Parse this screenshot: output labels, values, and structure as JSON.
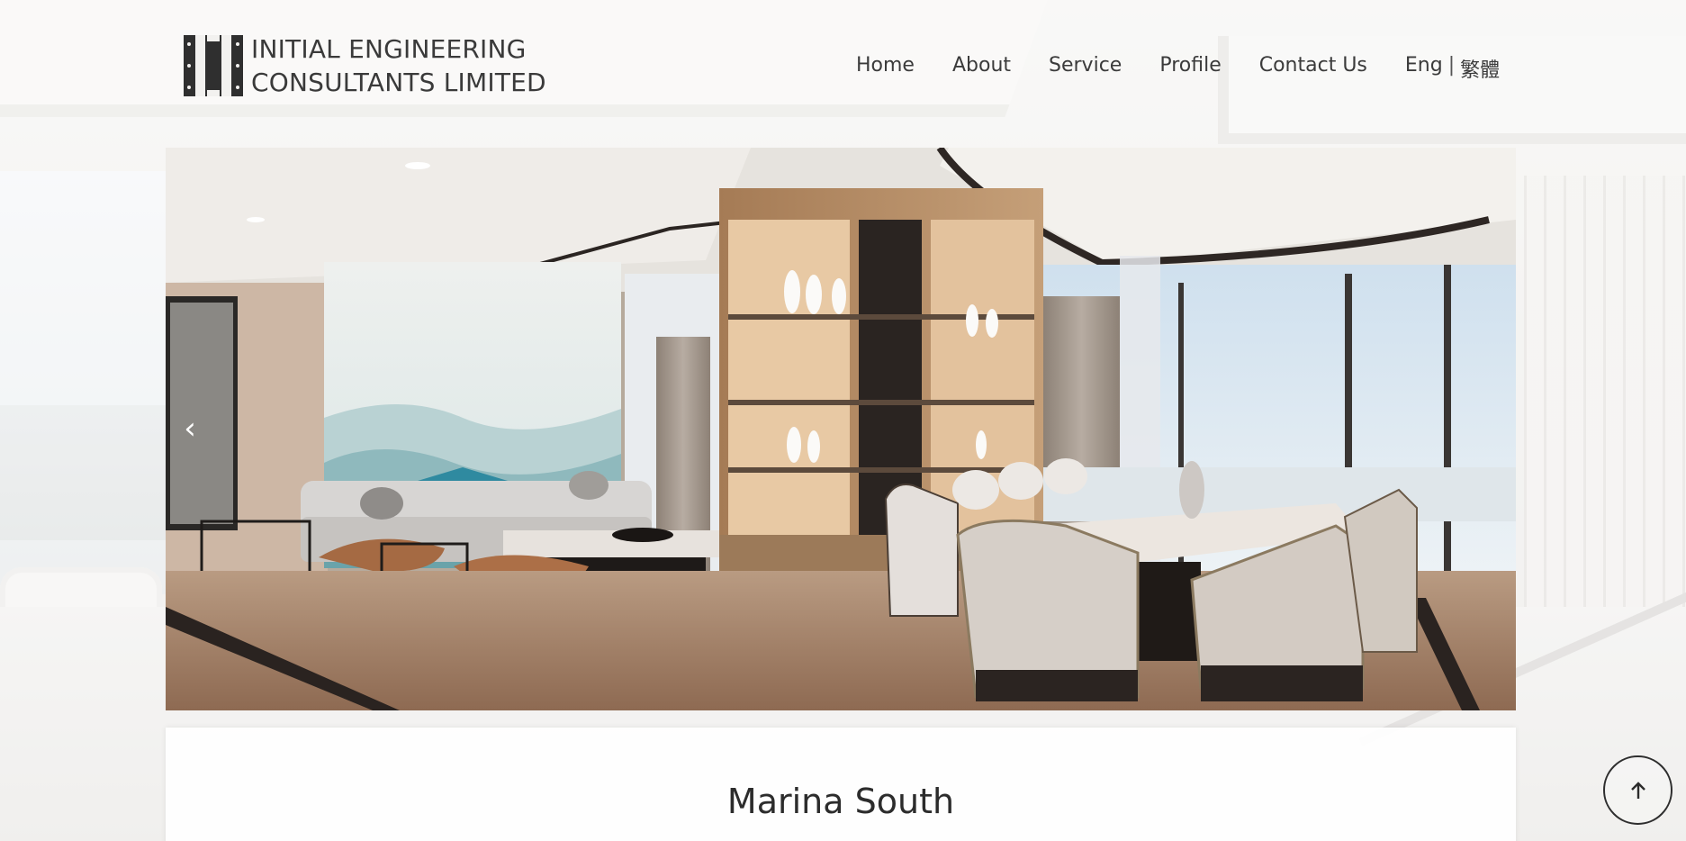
{
  "brand": {
    "line1": "INITIAL ENGINEERING",
    "line2": "CONSULTANTS LIMITED"
  },
  "nav": {
    "items": [
      {
        "label": "Home"
      },
      {
        "label": "About"
      },
      {
        "label": "Service"
      },
      {
        "label": "Profile"
      },
      {
        "label": "Contact Us"
      }
    ],
    "lang_en": "Eng",
    "lang_sep": "|",
    "lang_zh": "繁體"
  },
  "slider": {
    "prev_label": "‹"
  },
  "project": {
    "title": "Marina South"
  },
  "colors": {
    "text": "#3b3b3b",
    "logo": "#2f2f2f",
    "card_bg": "#ffffff"
  },
  "icons": {
    "prev": "chevron-left-icon",
    "to_top": "arrow-up-icon"
  }
}
